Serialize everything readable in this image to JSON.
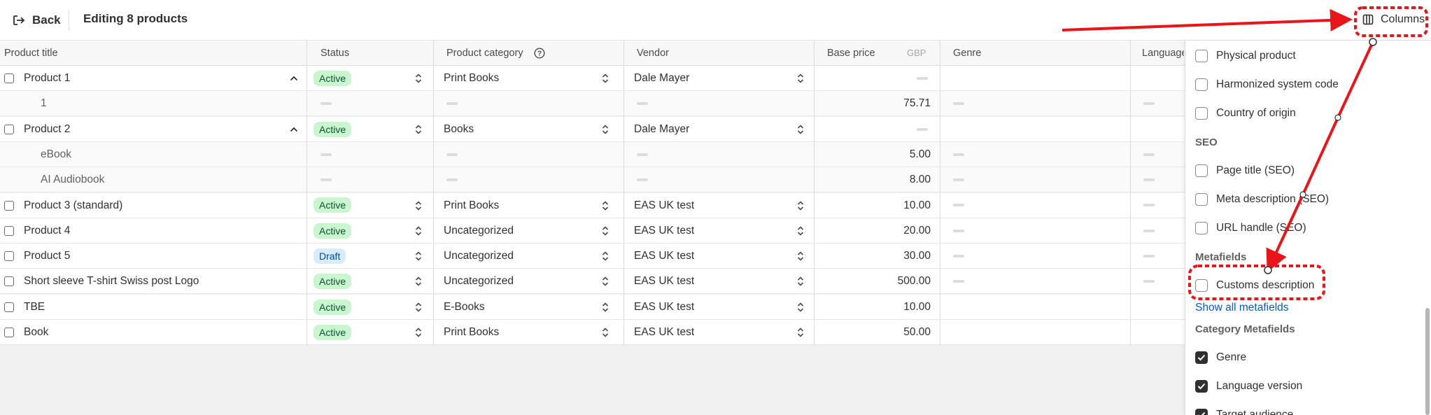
{
  "topbar": {
    "back_label": "Back",
    "title": "Editing 8 products",
    "columns_label": "Columns"
  },
  "columns": {
    "product_title": "Product title",
    "status": "Status",
    "category": "Product category",
    "vendor": "Vendor",
    "base_price": "Base price",
    "currency": "GBP",
    "genre": "Genre",
    "language": "Language"
  },
  "rows": [
    {
      "title": "Product 1",
      "status": "Active",
      "category": "Print Books",
      "vendor": "Dale Mayer",
      "price": "",
      "expanded": true
    },
    {
      "title": "1",
      "variant": true,
      "price": "75.71"
    },
    {
      "title": "Product 2",
      "status": "Active",
      "category": "Books",
      "vendor": "Dale Mayer",
      "price": "",
      "expanded": true
    },
    {
      "title": "eBook",
      "variant": true,
      "price": "5.00"
    },
    {
      "title": "AI Audiobook",
      "variant": true,
      "price": "8.00"
    },
    {
      "title": "Product 3 (standard)",
      "status": "Active",
      "category": "Print Books",
      "vendor": "EAS UK test",
      "price": "10.00"
    },
    {
      "title": "Product 4",
      "status": "Active",
      "category": "Uncategorized",
      "vendor": "EAS UK test",
      "price": "20.00"
    },
    {
      "title": "Product 5",
      "status": "Draft",
      "category": "Uncategorized",
      "vendor": "EAS UK test",
      "price": "30.00"
    },
    {
      "title": "Short sleeve T-shirt Swiss post Logo",
      "status": "Active",
      "category": "Uncategorized",
      "vendor": "EAS UK test",
      "price": "500.00"
    },
    {
      "title": "TBE",
      "status": "Active",
      "category": "E-Books",
      "vendor": "EAS UK test",
      "price": "10.00"
    },
    {
      "title": "Book",
      "status": "Active",
      "category": "Print Books",
      "vendor": "EAS UK test",
      "price": "50.00"
    }
  ],
  "panel": {
    "items_top": [
      {
        "label": "Physical product",
        "checked": false
      },
      {
        "label": "Harmonized system code",
        "checked": false
      },
      {
        "label": "Country of origin",
        "checked": false
      }
    ],
    "seo_heading": "SEO",
    "seo_items": [
      {
        "label": "Page title (SEO)",
        "checked": false
      },
      {
        "label": "Meta description (SEO)",
        "checked": false
      },
      {
        "label": "URL handle (SEO)",
        "checked": false
      }
    ],
    "metafields_heading": "Metafields",
    "metafield_items": [
      {
        "label": "Customs description",
        "checked": false
      }
    ],
    "show_all_link": "Show all metafields",
    "category_heading": "Category Metafields",
    "category_items": [
      {
        "label": "Genre",
        "checked": true
      },
      {
        "label": "Language version",
        "checked": true
      },
      {
        "label": "Target audience",
        "checked": true
      }
    ]
  },
  "colors": {
    "active_badge_bg": "#c9f5cf",
    "draft_badge_bg": "#d8ebff",
    "annotation_red": "#e8151b",
    "link_blue": "#005bd3"
  }
}
